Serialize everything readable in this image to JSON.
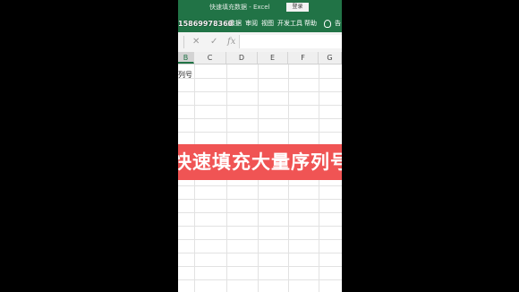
{
  "window": {
    "title": "快速填充数据 - Excel",
    "login_label": "登录"
  },
  "ribbon": {
    "overlay_text": "15869978360",
    "tabs": [
      "式",
      "数据",
      "审阅",
      "视图",
      "开发工具",
      "帮助"
    ],
    "extra_label": "告"
  },
  "formula_bar": {
    "cancel_symbol": "✕",
    "confirm_symbol": "✓",
    "fx_label": "fx",
    "value": ""
  },
  "columns": [
    "B",
    "C",
    "D",
    "E",
    "F",
    "G"
  ],
  "cells": {
    "B2": "列号"
  },
  "banner": {
    "text": "快速填充大量序列号"
  },
  "colors": {
    "excel_green": "#217346",
    "banner_red": "#f05454"
  }
}
